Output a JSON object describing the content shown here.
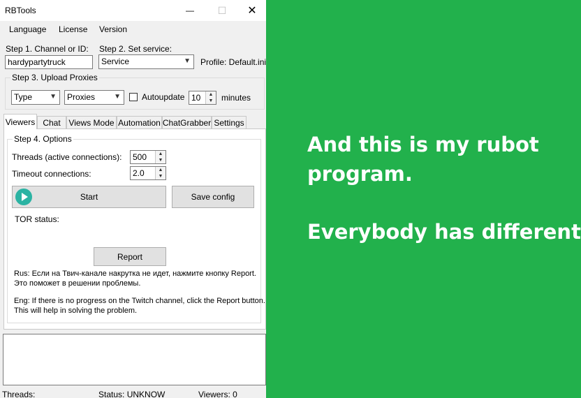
{
  "window": {
    "title": "RBTools",
    "controls": {
      "minimize": "—",
      "maximize": "☐",
      "close": "✕"
    }
  },
  "menu": [
    "Language",
    "License",
    "Version"
  ],
  "step1": {
    "label": "Step 1. Channel or ID:",
    "value": "hardypartytruck"
  },
  "step2": {
    "label": "Step 2. Set service:",
    "selected": "Service",
    "profile": "Profile: Default.ini"
  },
  "step3": {
    "title": "Step 3. Upload Proxies",
    "type_selected": "Type",
    "proxies_selected": "Proxies",
    "autoupdate_label": "Autoupdate",
    "autoupdate_checked": false,
    "minutes_value": "10",
    "minutes_label": "minutes"
  },
  "tabs": [
    {
      "label": "Viewers",
      "active": true
    },
    {
      "label": "Chat",
      "active": false
    },
    {
      "label": "Views Mode",
      "active": false
    },
    {
      "label": "Automation",
      "active": false
    },
    {
      "label": "ChatGrabber",
      "active": false
    },
    {
      "label": "Settings",
      "active": false
    }
  ],
  "step4": {
    "title": "Step 4. Options",
    "threads_label": "Threads (active connections):",
    "threads_value": "500",
    "timeout_label": "Timeout connections:",
    "timeout_value": "2.0",
    "start_label": "Start",
    "save_label": "Save config",
    "tor_status_label": "TOR status:",
    "report_label": "Report",
    "rus_line1": "Rus: Если на Твич-канале накрутка не идет, нажмите кнопку Report.",
    "rus_line2": "Это поможет в решении проблемы.",
    "eng_line1": "Eng: If there is no progress on the Twitch channel, click the Report button.",
    "eng_line2": "This will help in solving the problem."
  },
  "status": {
    "threads": "Threads:",
    "status": "Status: UNKNOW",
    "viewers": "Viewers: 0"
  },
  "caption": {
    "line1": "And this is my rubot",
    "line2": "program.",
    "line3": "Everybody has different?"
  },
  "colors": {
    "green_panel": "#22b14c",
    "play_icon": "#2bb3a3"
  }
}
